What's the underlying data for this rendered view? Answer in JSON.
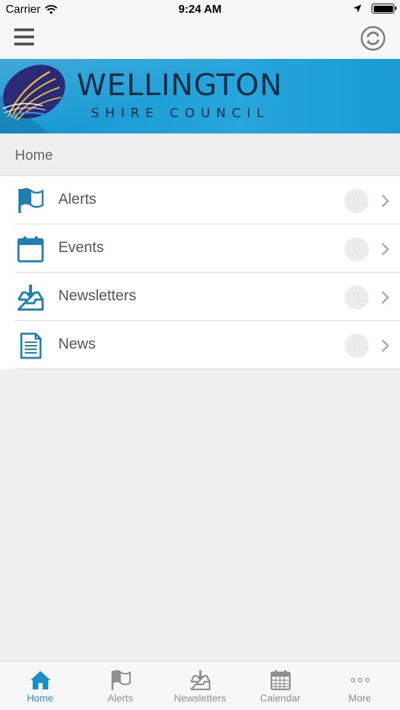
{
  "status_bar": {
    "carrier": "Carrier",
    "time": "9:24 AM",
    "icons": [
      "wifi-icon",
      "location-arrow-icon",
      "battery-icon"
    ]
  },
  "nav_bar": {
    "menu_icon": "hamburger-menu-icon",
    "refresh_icon": "refresh-icon"
  },
  "banner": {
    "title": "WELLINGTON",
    "subtitle": "SHIRE COUNCIL",
    "background_color": "#1c9ed7",
    "text_color": "#1b2c46"
  },
  "page_header": {
    "title": "Home"
  },
  "list": {
    "items": [
      {
        "label": "Alerts",
        "icon": "flag-icon",
        "count": "0"
      },
      {
        "label": "Events",
        "icon": "calendar-icon",
        "count": "0"
      },
      {
        "label": "Newsletters",
        "icon": "inbox-download-icon",
        "count": "0"
      },
      {
        "label": "News",
        "icon": "document-icon",
        "count": "0"
      }
    ]
  },
  "tab_bar": {
    "tabs": [
      {
        "label": "Home",
        "icon": "home-icon",
        "active": true
      },
      {
        "label": "Alerts",
        "icon": "flag-icon",
        "active": false
      },
      {
        "label": "Newsletters",
        "icon": "inbox-download-icon",
        "active": false
      },
      {
        "label": "Calendar",
        "icon": "calendar-icon",
        "active": false
      },
      {
        "label": "More",
        "icon": "more-dots-icon",
        "active": false
      }
    ]
  },
  "colors": {
    "accent": "#1a8fc4",
    "icon_blue": "#1f7fae",
    "inactive": "#8e8e8e"
  }
}
